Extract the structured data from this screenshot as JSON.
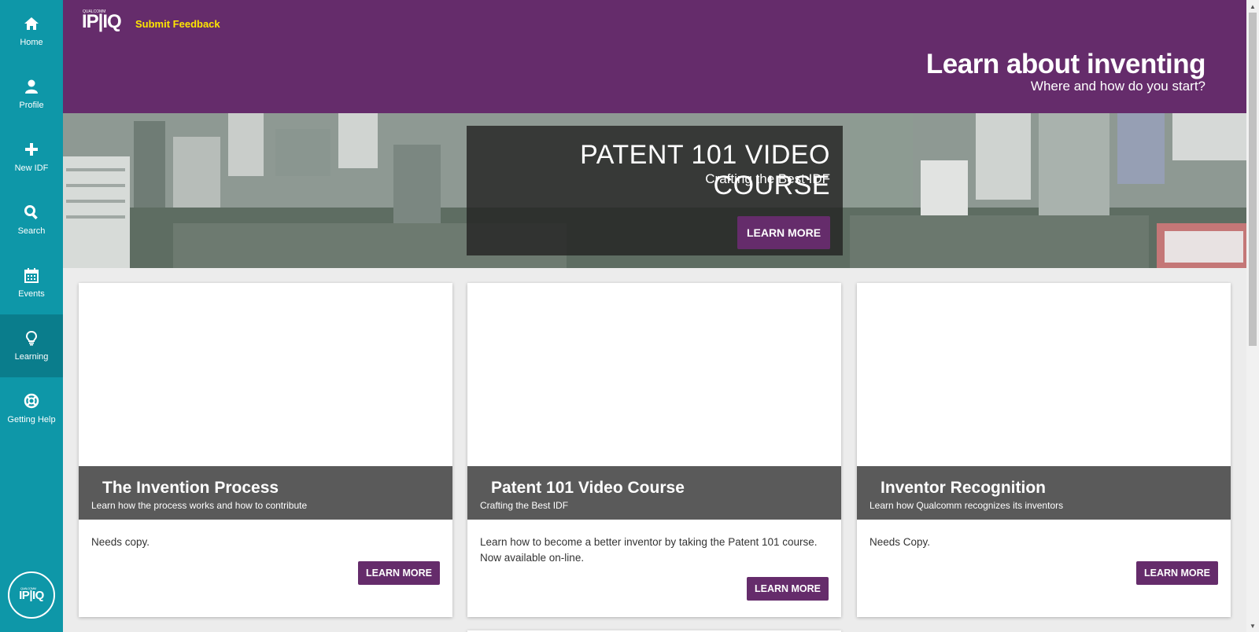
{
  "sidebar": {
    "items": [
      {
        "label": "Home",
        "icon": "home-icon",
        "active": false
      },
      {
        "label": "Profile",
        "icon": "user-icon",
        "active": false
      },
      {
        "label": "New IDF",
        "icon": "plus-icon",
        "active": false
      },
      {
        "label": "Search",
        "icon": "search-icon",
        "active": false
      },
      {
        "label": "Events",
        "icon": "calendar-icon",
        "active": false
      },
      {
        "label": "Learning",
        "icon": "lightbulb-icon",
        "active": true
      },
      {
        "label": "Getting Help",
        "icon": "lifebuoy-icon",
        "active": false
      }
    ],
    "logo_text": "IP|IQ",
    "logo_small": "QUALCOMM"
  },
  "header": {
    "logo_text": "IP|IQ",
    "logo_small": "QUALCOMM",
    "feedback_label": "Submit Feedback",
    "title": "Learn about inventing",
    "subtitle": "Where and how do you start?"
  },
  "banner": {
    "title": "PATENT 101 VIDEO COURSE",
    "subtitle": "Crafting the Best IDF",
    "button_label": "LEARN MORE"
  },
  "cards": [
    {
      "title": "The Invention Process",
      "subtitle": "Learn how the process works and how to contribute",
      "text": "Needs copy.",
      "button_label": "LEARN MORE"
    },
    {
      "title": "Patent 101 Video Course",
      "subtitle": "Crafting the Best IDF",
      "text": "Learn how to become a better inventor by taking the Patent 101 course. Now available on-line.",
      "button_label": "LEARN MORE"
    },
    {
      "title": "Inventor Recognition",
      "subtitle": "Learn how Qualcomm recognizes its inventors",
      "text": "Needs Copy.",
      "button_label": "LEARN MORE"
    }
  ],
  "colors": {
    "sidebar": "#0e97a8",
    "sidebar_active": "#0a7d8c",
    "brand_purple": "#652c6b",
    "feedback_yellow": "#ffe600",
    "card_band": "#5a5a5a"
  }
}
